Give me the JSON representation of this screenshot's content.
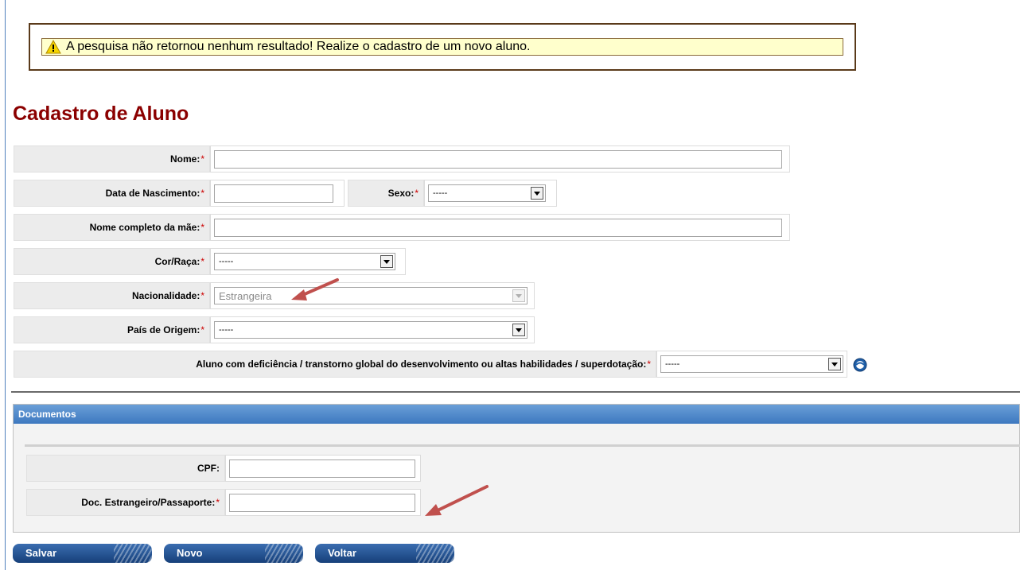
{
  "alert": {
    "message": "A pesquisa não retornou nenhum resultado! Realize o cadastro de um novo aluno.",
    "icon": "warning-icon"
  },
  "page_title": "Cadastro de Aluno",
  "form": {
    "nome": {
      "label": "Nome:",
      "required_mark": "*",
      "value": ""
    },
    "data_nascimento": {
      "label": "Data de Nascimento:",
      "required_mark": "*",
      "value": ""
    },
    "sexo": {
      "label": "Sexo:",
      "required_mark": "*",
      "value": "-----"
    },
    "nome_mae": {
      "label": "Nome completo da mãe:",
      "required_mark": "*",
      "value": ""
    },
    "cor_raca": {
      "label": "Cor/Raça:",
      "required_mark": "*",
      "value": "-----"
    },
    "nacionalidade": {
      "label": "Nacionalidade:",
      "required_mark": "*",
      "value": "Estrangeira",
      "disabled": true
    },
    "pais_origem": {
      "label": "País de Origem:",
      "required_mark": "*",
      "value": "-----"
    },
    "deficiencia": {
      "label": "Aluno com deficiência / transtorno global do desenvolvimento ou altas habilidades / superdotação:",
      "required_mark": "*",
      "value": "-----",
      "help_icon": "help-icon"
    }
  },
  "documentos": {
    "title": "Documentos",
    "cpf": {
      "label": "CPF:",
      "value": ""
    },
    "passaporte": {
      "label": "Doc. Estrangeiro/Passaporte:",
      "required_mark": "*",
      "value": ""
    }
  },
  "buttons": {
    "salvar": "Salvar",
    "novo": "Novo",
    "voltar": "Voltar"
  },
  "colors": {
    "title": "#8b0000",
    "alert_bg": "#ffffcc",
    "header_blue": "#3d78c0",
    "required": "#cc0000",
    "annotation_arrow": "#c0504d"
  }
}
